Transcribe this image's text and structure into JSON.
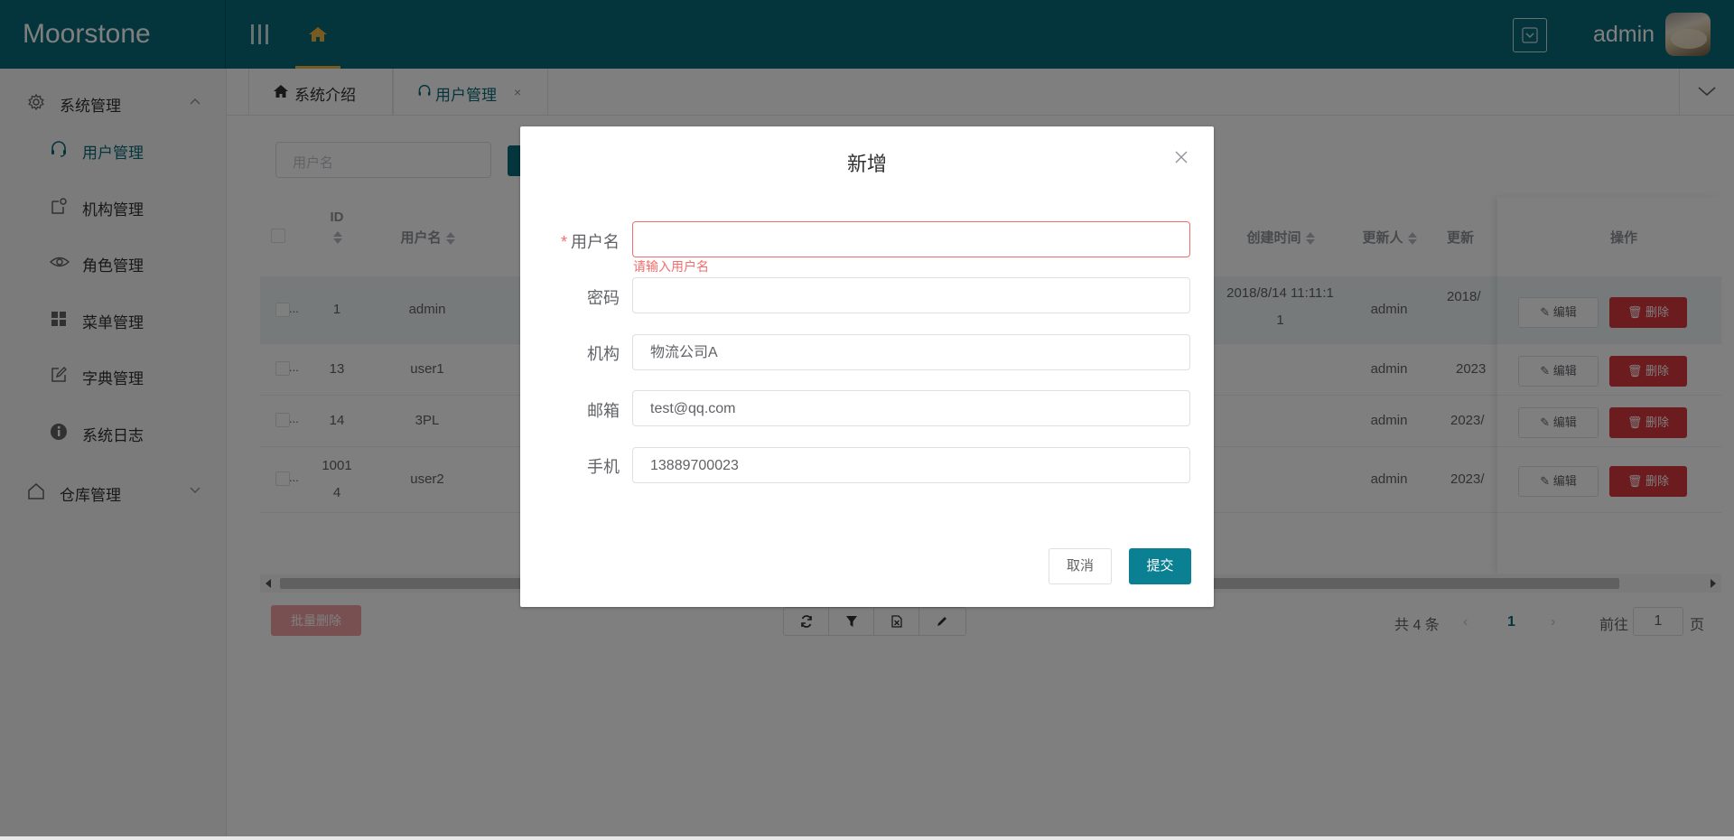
{
  "app": {
    "brand": "Moorstone",
    "user": "admin",
    "colors": {
      "primary": "#0b6a79",
      "accent": "#f1b740",
      "danger": "#d9363e",
      "error": "#f56c6c"
    }
  },
  "sidebar": {
    "groups": [
      {
        "label": "系统管理",
        "icon": "gear-icon",
        "expanded": true
      },
      {
        "label": "仓库管理",
        "icon": "house-icon",
        "expanded": false
      }
    ],
    "items": [
      {
        "label": "用户管理",
        "icon": "headset-icon",
        "active": true
      },
      {
        "label": "机构管理",
        "icon": "org-icon"
      },
      {
        "label": "角色管理",
        "icon": "eye-icon"
      },
      {
        "label": "菜单管理",
        "icon": "grid-icon"
      },
      {
        "label": "字典管理",
        "icon": "edit-icon"
      },
      {
        "label": "系统日志",
        "icon": "info-icon"
      }
    ]
  },
  "tabs": [
    {
      "label": "系统介绍",
      "icon": "home-icon"
    },
    {
      "label": "用户管理",
      "icon": "headset-icon",
      "active": true,
      "closable": true,
      "close": "×"
    }
  ],
  "search": {
    "placeholder": "用户名"
  },
  "table": {
    "columns": {
      "id": "ID",
      "username": "用户名",
      "created": "创建时间",
      "updater": "更新人",
      "updated": "更新",
      "actions": "操作"
    },
    "rows": [
      {
        "id": "1",
        "username": "admin",
        "created": "2018/8/14 11:11:1\n1",
        "updater": "admin",
        "updated": "2018/"
      },
      {
        "id": "13",
        "username": "user1",
        "created": "",
        "updater": "admin",
        "updated": "2023"
      },
      {
        "id": "14",
        "username": "3PL",
        "created": "",
        "updater": "admin",
        "updated": "2023/"
      },
      {
        "id": "1001\n4",
        "username": "user2",
        "created": "",
        "updater": "admin",
        "updated": "2023/"
      }
    ],
    "edit_label": "编辑",
    "delete_label": "删除",
    "row_check_suffix": "..."
  },
  "footer": {
    "batch_delete": "批量删除",
    "total": "共 4 条",
    "page": "1",
    "goto_label": "前往",
    "goto_value": "1",
    "page_unit": "页"
  },
  "dialog": {
    "title": "新增",
    "fields": [
      {
        "label": "用户名",
        "required": true,
        "value": "",
        "error": "请输入用户名"
      },
      {
        "label": "密码",
        "value": ""
      },
      {
        "label": "机构",
        "value": "物流公司A"
      },
      {
        "label": "邮箱",
        "value": "test@qq.com"
      },
      {
        "label": "手机",
        "value": "13889700023"
      }
    ],
    "required_mark": "*",
    "cancel": "取消",
    "submit": "提交"
  }
}
